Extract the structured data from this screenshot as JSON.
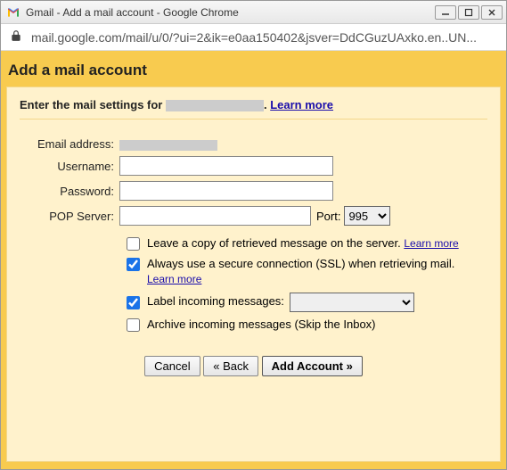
{
  "window": {
    "title": "Gmail - Add a mail account - Google Chrome"
  },
  "address": {
    "url": "mail.google.com/mail/u/0/?ui=2&ik=e0aa150402&jsver=DdCGuzUAxko.en..UN..."
  },
  "page": {
    "title": "Add a mail account",
    "intro_prefix": "Enter the mail settings for ",
    "intro_suffix": ". ",
    "learn_more": "Learn more"
  },
  "labels": {
    "email": "Email address:",
    "username": "Username:",
    "password": "Password:",
    "pop": "POP Server:",
    "port": "Port:"
  },
  "port": {
    "selected": "995"
  },
  "options": {
    "leave_copy": "Leave a copy of retrieved message on the server.",
    "leave_copy_link": "Learn more",
    "ssl": "Always use a secure connection (SSL) when retrieving mail.",
    "ssl_link": "Learn more",
    "label_msgs": "Label incoming messages:",
    "archive": "Archive incoming messages (Skip the Inbox)"
  },
  "buttons": {
    "cancel": "Cancel",
    "back": "« Back",
    "add": "Add Account »"
  }
}
